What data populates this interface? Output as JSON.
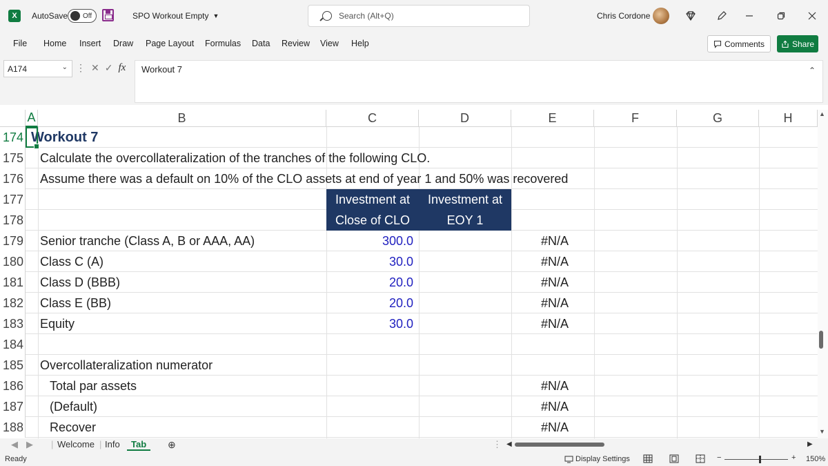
{
  "titlebar": {
    "autosave_label": "AutoSave",
    "autosave_state": "Off",
    "file_name": "SPO Workout Empty",
    "search_placeholder": "Search (Alt+Q)",
    "user_name": "Chris Cordone",
    "logo_text": "X"
  },
  "ribbon": {
    "tabs": [
      "File",
      "Home",
      "Insert",
      "Draw",
      "Page Layout",
      "Formulas",
      "Data",
      "Review",
      "View",
      "Help"
    ],
    "comments_label": "Comments",
    "share_label": "Share"
  },
  "formula_bar": {
    "name_box": "A174",
    "fx": "fx",
    "content": "Workout 7"
  },
  "columns": [
    "A",
    "B",
    "C",
    "D",
    "E",
    "F",
    "G",
    "H"
  ],
  "rows": [
    {
      "num": "174",
      "b": "Workout 7",
      "c": "",
      "d": "",
      "e": ""
    },
    {
      "num": "175",
      "b": "Calculate the overcollateralization of the tranches of the following CLO.",
      "c": "",
      "d": "",
      "e": ""
    },
    {
      "num": "176",
      "b": "Assume there was a default on 10% of the CLO assets at end of year 1 and 50% was recovered",
      "c": "",
      "d": "",
      "e": ""
    },
    {
      "num": "177",
      "b": "",
      "c": "Investment at",
      "d": "Investment at",
      "e": ""
    },
    {
      "num": "178",
      "b": "",
      "c": "Close of CLO",
      "d": "EOY 1",
      "e": ""
    },
    {
      "num": "179",
      "b": "Senior tranche (Class A, B or AAA, AA)",
      "c": "300.0",
      "d": "",
      "e": "#N/A"
    },
    {
      "num": "180",
      "b": "Class C (A)",
      "c": "30.0",
      "d": "",
      "e": "#N/A"
    },
    {
      "num": "181",
      "b": "Class D (BBB)",
      "c": "20.0",
      "d": "",
      "e": "#N/A"
    },
    {
      "num": "182",
      "b": "Class E (BB)",
      "c": "20.0",
      "d": "",
      "e": "#N/A"
    },
    {
      "num": "183",
      "b": "Equity",
      "c": "30.0",
      "d": "",
      "e": "#N/A"
    },
    {
      "num": "184",
      "b": "",
      "c": "",
      "d": "",
      "e": ""
    },
    {
      "num": "185",
      "b": "Overcollateralization numerator",
      "c": "",
      "d": "",
      "e": ""
    },
    {
      "num": "186",
      "b": "Total par assets",
      "c": "",
      "d": "",
      "e": "#N/A"
    },
    {
      "num": "187",
      "b": "(Default)",
      "c": "",
      "d": "",
      "e": "#N/A"
    },
    {
      "num": "188",
      "b": "Recover",
      "c": "",
      "d": "",
      "e": "#N/A"
    }
  ],
  "sheets": [
    "Welcome",
    "Info",
    "Tab"
  ],
  "active_sheet": "Tab",
  "status": {
    "ready": "Ready",
    "display_settings": "Display Settings",
    "zoom": "150%"
  },
  "colors": {
    "accent": "#107c41",
    "header_fill": "#1f3864",
    "input_blue": "#1f1fbf"
  }
}
